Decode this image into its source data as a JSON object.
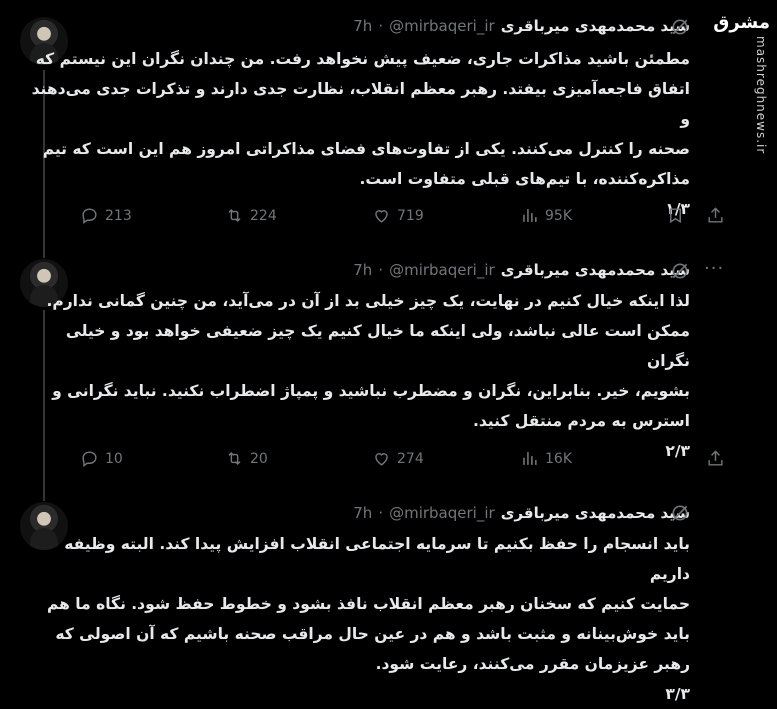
{
  "watermark": {
    "logo": "مشرق",
    "site": "mashreghnews.ir"
  },
  "tweets": [
    {
      "name": "سید محمدمهدی میرباقری",
      "handle": "@mirbaqeri_ir",
      "dot": "·",
      "time": "7h",
      "more": "···",
      "lines": [
        "مطمئن باشید مذاکرات جاری، ضعیف پیش نخواهد رفت. من چندان نگران این نیستم که",
        "اتفاق فاجعه‌آمیزی بیفتد. رهبر معظم انقلاب، نظارت جدی دارند و تذکرات جدی می‌دهند و",
        "صحنه را کنترل می‌کنند. یکی از تفاوت‌های فضای مذاکراتی امروز هم این است که تیم",
        "مذاکره‌کننده، با تیم‌های قبلی متفاوت است."
      ],
      "counter": "۱/۳",
      "replies": "213",
      "reposts": "224",
      "likes": "719",
      "views": "95K"
    },
    {
      "name": "سید محمدمهدی میرباقری",
      "handle": "@mirbaqeri_ir",
      "dot": "·",
      "time": "7h",
      "more": "···",
      "lines": [
        "لذا اینکه خیال کنیم در نهایت، یک چیز خیلی بد از آن در می‌آید، من چنین گمانی ندارم.",
        "ممکن است عالی نباشد، ولی اینکه ما خیال کنیم یک چیز ضعیفی خواهد بود و خیلی نگران",
        "بشویم، خیر. بنابراین، نگران و مضطرب نباشید و پمپاژ اضطراب نکنید. نباید نگرانی و",
        "استرس به مردم منتقل کنید."
      ],
      "counter": "۲/۳",
      "replies": "10",
      "reposts": "20",
      "likes": "274",
      "views": "16K"
    },
    {
      "name": "سید محمدمهدی میرباقری",
      "handle": "@mirbaqeri_ir",
      "dot": "·",
      "time": "7h",
      "more": "",
      "lines": [
        "باید انسجام را حفظ بکنیم تا سرمایه اجتماعی انقلاب افزایش پیدا کند. البته وظیفه داریم",
        "حمایت کنیم که سخنان رهبر معظم انقلاب نافذ بشود و خطوط حفظ شود. نگاه ما هم",
        "باید خوش‌بینانه و مثبت باشد و هم در عین حال مراقب صحنه باشیم که آن اصولی که",
        "رهبر عزیزمان مقرر می‌کنند، رعایت شود."
      ],
      "counter": "۳/۳"
    }
  ]
}
